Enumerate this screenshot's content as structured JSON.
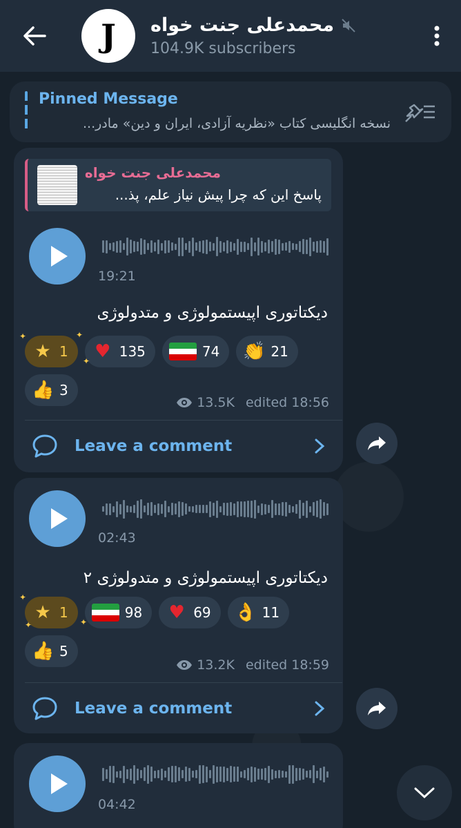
{
  "header": {
    "title": "محمدعلی جنت خواه",
    "subscribers": "104.9K subscribers",
    "avatar_letter": "J"
  },
  "pinned": {
    "title": "Pinned Message",
    "text": "نسخه انگلیسی کتاب «نظریه آزادی، ایران و دین» مادر..."
  },
  "messages": [
    {
      "reply_name": "محمدعلی جنت خواه",
      "reply_text": "پاسخ این که چرا پیش نیاز علم، پذ...",
      "duration": "19:21",
      "text": "دیکتاتوری اپیستمولوژی و متدولوژی",
      "reactions": [
        {
          "icon": "star-icon",
          "count": "1",
          "paid": true
        },
        {
          "icon": "heart-icon",
          "count": "135"
        },
        {
          "icon": "iran-flag-icon",
          "count": "74"
        },
        {
          "icon": "clap-icon",
          "count": "21"
        },
        {
          "icon": "thumbs-up-icon",
          "count": "3"
        }
      ],
      "views": "13.5K",
      "edited": "edited 18:56",
      "comment_label": "Leave a comment"
    },
    {
      "duration": "02:43",
      "text": "دیکتاتوری اپیستمولوژی و متدولوژی ۲",
      "reactions": [
        {
          "icon": "star-icon",
          "count": "1",
          "paid": true
        },
        {
          "icon": "iran-flag-icon",
          "count": "98"
        },
        {
          "icon": "heart-icon",
          "count": "69"
        },
        {
          "icon": "ok-hand-icon",
          "count": "11"
        },
        {
          "icon": "thumbs-up-icon",
          "count": "5"
        }
      ],
      "views": "13.2K",
      "edited": "edited 18:59",
      "comment_label": "Leave a comment"
    },
    {
      "duration": "04:42"
    }
  ],
  "colors": {
    "accent": "#6cb4ee",
    "bubble": "#212d3b",
    "background": "#17212b",
    "play": "#5e9fd6"
  }
}
